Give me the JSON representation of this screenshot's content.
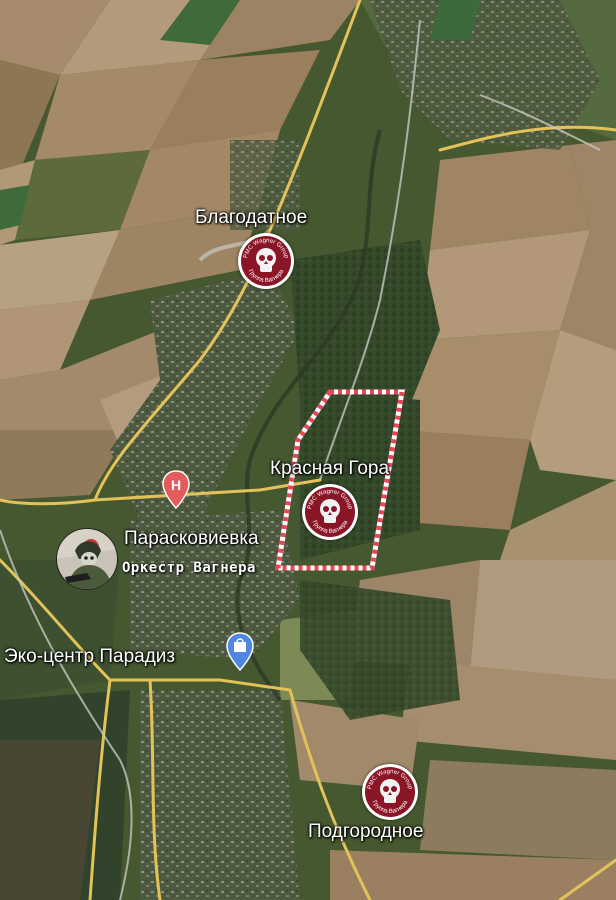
{
  "map": {
    "places": {
      "blagodatnoe": "Благодатное",
      "krasnaya_gora": "Красная Гора",
      "paraskovievka": "Парасковиевка",
      "eko_centr": "Эко-центр Парадиз",
      "podgorodnoe": "Подгородное"
    },
    "channel_caption": "Оркестр Вагнера",
    "emblem_text_top": "PMC Wagner Group",
    "emblem_text_bottom": "Группа Вагнера",
    "colors": {
      "road": "#e3c25a",
      "highlight_border": "#e8455a",
      "emblem_red": "#8a1526",
      "hotel_pin": "#e35b5b",
      "place_pin": "#4f86e0"
    },
    "icons": {
      "hotel": "hotel-pin-icon",
      "eco_center": "shopping-bag-pin-icon",
      "emblem": "wagner-emblem-icon"
    }
  }
}
